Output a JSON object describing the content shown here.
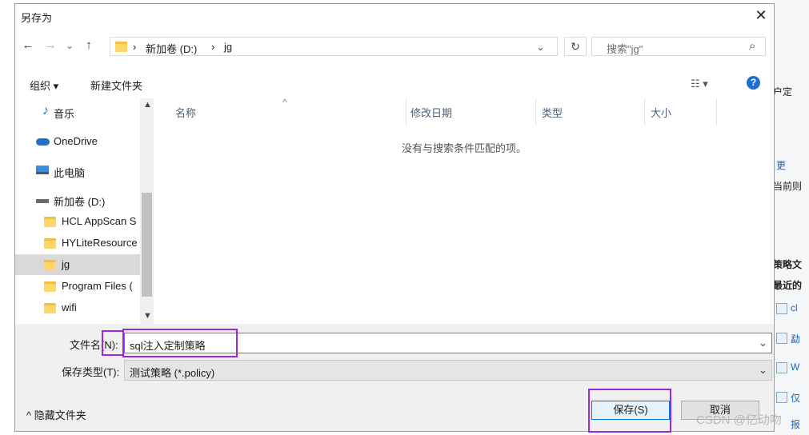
{
  "dialog": {
    "title": "另存为",
    "close_glyph": "✕"
  },
  "nav_buttons": {
    "back": "←",
    "forward": "→",
    "recent": "⌄",
    "up": "↑"
  },
  "address": {
    "crumbs": [
      "新加卷 (D:)",
      "jg"
    ],
    "separator": "›",
    "dropdown_glyph": "⌄",
    "refresh_glyph": "↻"
  },
  "search": {
    "placeholder": "搜索\"jg\"",
    "icon_glyph": "⌕"
  },
  "toolbar": {
    "organize_label": "组织 ▾",
    "new_folder_label": "新建文件夹",
    "view_glyph": "☷ ▾",
    "help_glyph": "?"
  },
  "sidebar": {
    "items": [
      {
        "label": "音乐",
        "icon": "music-icon"
      },
      {
        "label": "OneDrive",
        "icon": "cloud-icon"
      },
      {
        "label": "此电脑",
        "icon": "computer-icon"
      },
      {
        "label": "新加卷 (D:)",
        "icon": "drive-icon"
      },
      {
        "label": "HCL AppScan S",
        "icon": "folder-icon"
      },
      {
        "label": "HYLiteResource",
        "icon": "folder-icon"
      },
      {
        "label": "jg",
        "icon": "folder-icon",
        "selected": true
      },
      {
        "label": "Program Files (",
        "icon": "folder-icon"
      },
      {
        "label": "wifi",
        "icon": "folder-icon"
      }
    ]
  },
  "file_list": {
    "columns": [
      "名称",
      "修改日期",
      "类型",
      "大小"
    ],
    "sort_glyph": "^",
    "empty_message": "没有与搜索条件匹配的项。"
  },
  "form": {
    "filename_label": "文件名(N):",
    "filename_value": "sql注入定制策略",
    "type_label": "保存类型(T):",
    "type_value": "测试策略 (*.policy)",
    "dropdown_glyph": "⌄"
  },
  "footer": {
    "hide_folders_label": "^  隐藏文件夹",
    "save_label": "保存(S)",
    "cancel_label": "取消"
  },
  "background_app": {
    "texts": [
      "户定",
      "更",
      "当前则",
      "策略文",
      "最近的",
      "cl",
      "勐",
      "W",
      "仅",
      "报"
    ]
  },
  "watermark": "CSDN @亿动吻",
  "colors": {
    "accent": "#1e6fd0",
    "highlight": "#9c27e0",
    "selected_bg": "#d9d9d9",
    "folder": "#ffd669"
  }
}
